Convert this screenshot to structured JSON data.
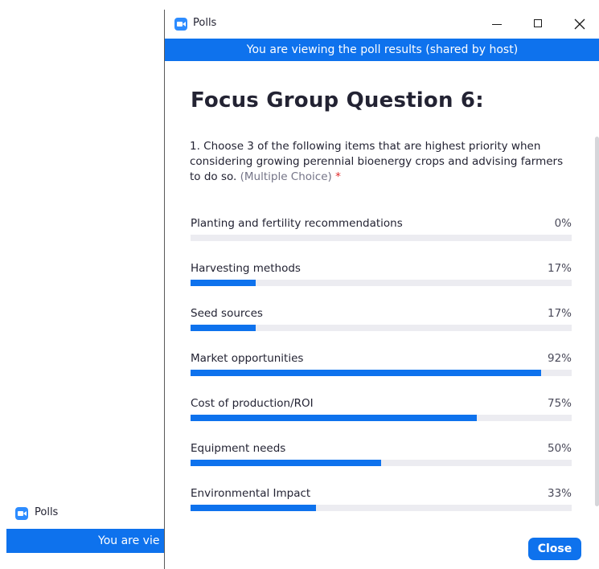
{
  "window": {
    "title": "Polls",
    "banner": "You are viewing the poll results (shared by host)"
  },
  "background_window": {
    "title": "Polls",
    "banner_fragment": "You are vie"
  },
  "poll": {
    "title": "Focus Group Question 6:",
    "question": "1. Choose 3 of the following items that are highest priority when considering growing perennial bioenergy crops and advising farmers to do so.",
    "question_type": "(Multiple Choice)",
    "required_marker": "*",
    "answers": [
      {
        "label": "Planting and fertility recommendations",
        "percent_text": "0%",
        "percent": 0
      },
      {
        "label": "Harvesting methods",
        "percent_text": "17%",
        "percent": 17
      },
      {
        "label": "Seed sources",
        "percent_text": "17%",
        "percent": 17
      },
      {
        "label": "Market opportunities",
        "percent_text": "92%",
        "percent": 92
      },
      {
        "label": "Cost of production/ROI",
        "percent_text": "75%",
        "percent": 75
      },
      {
        "label": "Equipment needs",
        "percent_text": "50%",
        "percent": 50
      },
      {
        "label": "Environmental Impact",
        "percent_text": "33%",
        "percent": 33
      }
    ]
  },
  "footer": {
    "close_label": "Close"
  },
  "icons": {
    "app": "zoom-camera-icon",
    "minimize": "minimize-icon",
    "maximize": "maximize-icon",
    "close": "close-icon"
  },
  "colors": {
    "accent": "#0e72ed",
    "track": "#ececf1",
    "required": "#e02828"
  }
}
